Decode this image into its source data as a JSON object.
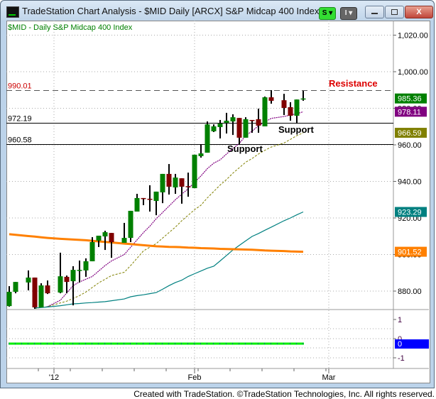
{
  "window": {
    "title": "TradeStation Chart Analysis - $MID Daily [ARCX] S&P Midcap 400 Index",
    "s_button": "S",
    "i_button": "I",
    "close_label": "X"
  },
  "chart_header": "$MID - Daily  S&P Midcap 400 Index",
  "footer": "Created with TradeStation. ©TradeStation Technologies, Inc. All rights reserved.",
  "chart_data": {
    "type": "candlestick",
    "symbol": "$MID",
    "ylim": [
      865,
      1027
    ],
    "grid": true,
    "y_ticks": [
      "1,020.00",
      "1,000.00",
      "980.00",
      "960.00",
      "940.00",
      "920.00",
      "900.00",
      "880.00"
    ],
    "y_tick_values": [
      1020,
      1000,
      980,
      960,
      940,
      920,
      900,
      880
    ],
    "x_ticks": [
      {
        "label": "'12",
        "date": "2012-01-02"
      },
      {
        "label": "Feb",
        "date": "2012-02-01"
      },
      {
        "label": "Mar",
        "date": "2012-03-01"
      }
    ],
    "ohlc_fields": [
      "date",
      "open",
      "high",
      "low",
      "close"
    ],
    "ohlc": [
      [
        "2011-12-22",
        871.8,
        882.7,
        871.5,
        879.6
      ],
      [
        "2011-12-23",
        879.6,
        885.0,
        878.8,
        885.0
      ],
      [
        "2011-12-27",
        884.7,
        891.3,
        880.4,
        887.4
      ],
      [
        "2011-12-28",
        887.4,
        887.4,
        870.3,
        871.1
      ],
      [
        "2011-12-29",
        871.1,
        884.3,
        871.1,
        883.1
      ],
      [
        "2011-12-30",
        883.1,
        885.8,
        878.4,
        878.8
      ],
      [
        "2012-01-03",
        879.2,
        901.0,
        878.8,
        888.1
      ],
      [
        "2012-01-04",
        887.8,
        888.5,
        878.8,
        885.0
      ],
      [
        "2012-01-05",
        885.4,
        893.6,
        872.2,
        891.6
      ],
      [
        "2012-01-06",
        891.6,
        896.7,
        884.7,
        891.6
      ],
      [
        "2012-01-09",
        891.3,
        897.9,
        887.8,
        896.3
      ],
      [
        "2012-01-10",
        896.3,
        909.5,
        896.3,
        906.8
      ],
      [
        "2012-01-11",
        907.6,
        910.3,
        904.1,
        910.3
      ],
      [
        "2012-01-12",
        909.9,
        913.0,
        902.5,
        912.2
      ],
      [
        "2012-01-13",
        911.8,
        911.8,
        898.2,
        906.8
      ],
      [
        "2012-01-17",
        906.4,
        917.3,
        906.4,
        909.1
      ],
      [
        "2012-01-18",
        909.1,
        923.9,
        906.8,
        923.9
      ],
      [
        "2012-01-19",
        923.5,
        933.2,
        923.5,
        930.9
      ],
      [
        "2012-01-20",
        930.9,
        930.9,
        927.0,
        930.5
      ],
      [
        "2012-01-23",
        930.5,
        937.9,
        923.5,
        930.4
      ],
      [
        "2012-01-24",
        929.3,
        934.4,
        921.5,
        934.4
      ],
      [
        "2012-01-25",
        934.0,
        944.1,
        928.1,
        944.1
      ],
      [
        "2012-01-26",
        944.1,
        949.5,
        932.8,
        937.1
      ],
      [
        "2012-01-27",
        936.7,
        944.1,
        933.2,
        942.1
      ],
      [
        "2012-01-30",
        941.7,
        941.7,
        927.8,
        937.1
      ],
      [
        "2012-01-31",
        937.4,
        944.8,
        931.6,
        936.9
      ],
      [
        "2012-02-01",
        936.3,
        954.6,
        936.3,
        954.6
      ],
      [
        "2012-02-02",
        953.8,
        960.4,
        953.0,
        955.3
      ],
      [
        "2012-02-03",
        955.7,
        972.8,
        955.7,
        971.2
      ],
      [
        "2012-02-06",
        967.4,
        971.2,
        967.0,
        970.1
      ],
      [
        "2012-02-07",
        969.7,
        973.6,
        963.5,
        971.6
      ],
      [
        "2012-02-08",
        972.0,
        977.5,
        966.2,
        973.2
      ],
      [
        "2012-02-09",
        972.8,
        976.7,
        965.4,
        975.1
      ],
      [
        "2012-02-10",
        974.7,
        974.7,
        960.4,
        963.9
      ],
      [
        "2012-02-13",
        963.9,
        975.1,
        963.9,
        974.0
      ],
      [
        "2012-02-14",
        973.6,
        973.6,
        966.6,
        973.2
      ],
      [
        "2012-02-15",
        974.0,
        979.8,
        966.6,
        970.5
      ],
      [
        "2012-02-16",
        970.1,
        986.4,
        970.1,
        986.0
      ],
      [
        "2012-02-17",
        986.0,
        989.9,
        982.5,
        984.1
      ],
      [
        "2012-02-21",
        984.4,
        987.9,
        976.3,
        980.2
      ],
      [
        "2012-02-22",
        980.6,
        983.3,
        973.2,
        975.9
      ],
      [
        "2012-02-23",
        975.9,
        984.8,
        971.6,
        984.8
      ],
      [
        "2012-02-24",
        985.0,
        989.5,
        984.1,
        985.36
      ]
    ],
    "up_color": "#008000",
    "down_color": "#800000",
    "last_price": {
      "label": "985.36",
      "color": "#008000"
    },
    "moving_averages": [
      {
        "color": "#800080",
        "style": "dotted",
        "last_label": "978.11",
        "values": [
          null,
          null,
          null,
          null,
          null,
          871.5,
          875,
          879,
          883,
          885,
          886.5,
          888,
          891,
          894,
          896.5,
          900,
          904,
          908,
          912,
          915.5,
          919.6,
          923,
          926.5,
          930,
          933,
          936,
          939.5,
          943,
          947,
          950,
          951.8,
          955,
          958,
          960.8,
          965,
          967.5,
          970.5,
          972.5,
          974.5,
          975.5,
          976.3,
          977,
          978.11
        ]
      },
      {
        "color": "#808000",
        "style": "dashed",
        "last_label": "966.59",
        "values": [
          null,
          null,
          null,
          870.5,
          871,
          871.5,
          873.5,
          874.5,
          876,
          877.5,
          879.5,
          882,
          884.5,
          886.5,
          888.5,
          890.3,
          894,
          898,
          902,
          904,
          906,
          909,
          912,
          915,
          918.5,
          921.5,
          924.5,
          927,
          931,
          934.5,
          938,
          941,
          944.5,
          947.5,
          950.5,
          952.5,
          955,
          957,
          958.8,
          961,
          963,
          965,
          966.59
        ]
      },
      {
        "color": "#008080",
        "style": "solid",
        "last_label": "923.29",
        "values": [
          null,
          null,
          null,
          870.7,
          871,
          871.3,
          872,
          872.5,
          873,
          873.2,
          873.5,
          873.7,
          874,
          874.2,
          874.7,
          875.7,
          876.9,
          877.5,
          878,
          878.6,
          879.2,
          881,
          883,
          884.7,
          886,
          888,
          889.5,
          891,
          892.5,
          893.6,
          896.5,
          899.5,
          902.5,
          905,
          907.5,
          909.9,
          911.5,
          913.3,
          915,
          918.5,
          920,
          921.7,
          923.29
        ]
      },
      {
        "color": "#ff8000",
        "style": "thick",
        "last_label": "901.52",
        "values": [
          911.1,
          910.8,
          910.1,
          909.8,
          909.4,
          909.1,
          908.6,
          908.4,
          908.2,
          908,
          907.8,
          907.5,
          907.2,
          906.9,
          906.6,
          906,
          905.7,
          905.4,
          905.1,
          904.8,
          904.5,
          904.4,
          904.2,
          904.1,
          904,
          903.8,
          903.7,
          903.5,
          903.4,
          903.3,
          903.1,
          903,
          902.9,
          902.8,
          902.7,
          902.6,
          902.4,
          902.2,
          902.1,
          901.9,
          901.7,
          901.6,
          901.52
        ]
      }
    ],
    "levels": [
      {
        "value": 990.01,
        "label": "990.01",
        "style": "dashed",
        "color": "#cc0000",
        "label_color": "#cc0000"
      },
      {
        "value": 972.19,
        "label": "972.19",
        "style": "solid",
        "color": "#000000",
        "label_color": "#000000"
      },
      {
        "value": 960.58,
        "label": "960.58",
        "style": "solid",
        "color": "#000000",
        "label_color": "#000000"
      }
    ],
    "annotations": [
      {
        "text": "Resistance",
        "color": "#dd0000"
      },
      {
        "text": "Support",
        "color": "#000000"
      },
      {
        "text": "Support",
        "color": "#000000"
      }
    ],
    "indicator": {
      "y_ticks": [
        "1",
        "0",
        "-1"
      ],
      "y_tick_values": [
        1,
        0,
        -1
      ],
      "value": 0,
      "last_label": "0",
      "last_color": "#0000ff",
      "line_color": "#00ee00"
    }
  }
}
